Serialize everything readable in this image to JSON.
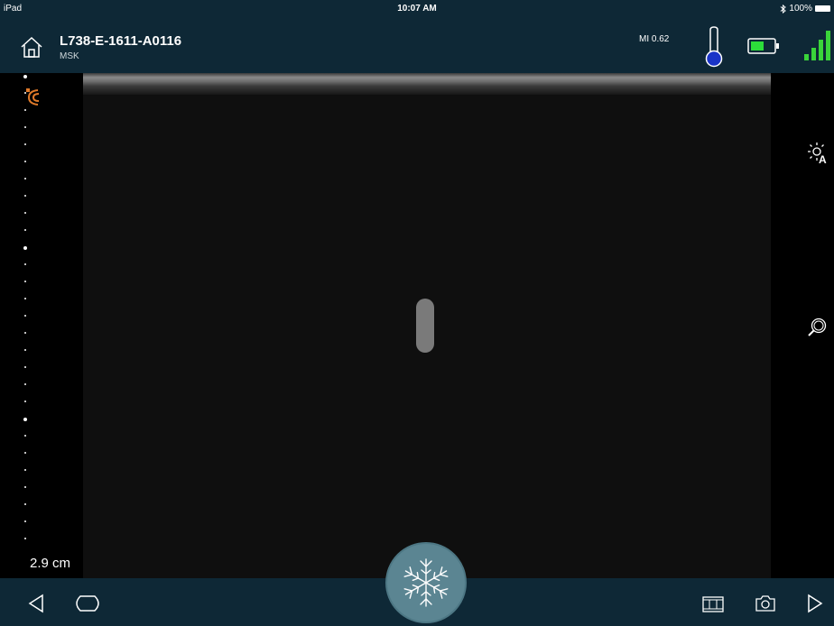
{
  "status_bar": {
    "device": "iPad",
    "time": "10:07 AM",
    "battery_percent": "100%",
    "bluetooth_icon": "bluetooth-icon"
  },
  "header": {
    "probe_name": "L738-E-1611-A0116",
    "preset": "MSK",
    "mi_label": "MI 0.62",
    "home_icon": "home-icon",
    "thermometer_icon": "thermometer-icon",
    "battery_icon": "battery-icon",
    "signal_icon": "signal-strength-icon",
    "colors": {
      "bar_bg": "#0e2836",
      "thermo_fill": "#1a34c8",
      "battery_fill": "#2cdc3a",
      "signal": "#3ad43a",
      "probe_orange": "#e07a2a"
    }
  },
  "left_rail": {
    "probe_orientation_icon": "probe-orientation-icon",
    "depth_label": "2.9 cm"
  },
  "right_rail": {
    "auto_gain_icon": "auto-gain-icon",
    "zoom_icon": "zoom-icon"
  },
  "bottom_bar": {
    "back_icon": "triangle-left-icon",
    "preset_shape_icon": "probe-shape-icon",
    "freeze_icon": "snowflake-icon",
    "cine_icon": "filmstrip-icon",
    "capture_icon": "camera-icon",
    "forward_icon": "triangle-right-icon",
    "freeze_color": "#5b8592"
  }
}
